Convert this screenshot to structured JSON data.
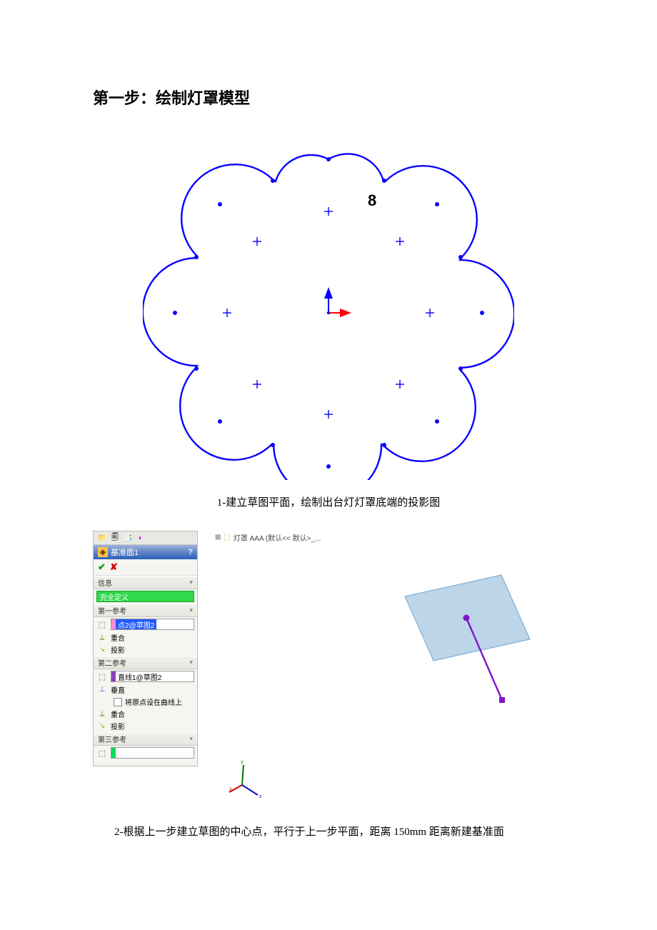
{
  "title": "第一步：绘制灯罩模型",
  "figure1": {
    "label8": "8",
    "caption": "1-建立草图平面，绘制出台灯灯罩底端的投影图"
  },
  "panel": {
    "feature_title": "基准面1",
    "ok": "✔",
    "cancel": "✘",
    "section_info": "信息",
    "msg_defined": "完全定义",
    "section_ref1": "第一参考",
    "ref1_value": "点2@草图2",
    "opt_coincident": "重合",
    "opt_project": "投影",
    "section_ref2": "第二参考",
    "ref2_value": "直线1@草图2",
    "opt_perpendicular": "垂直",
    "opt_origin_on_curve": "将原点设在曲线上",
    "section_ref3": "第三参考"
  },
  "viewport": {
    "crumb_text": "灯罩 AAA  (默认<< 默认>_..."
  },
  "figure2": {
    "caption": "2-根据上一步建立草图的中心点，平行于上一步平面，距离 150mm 距离新建基准面"
  }
}
